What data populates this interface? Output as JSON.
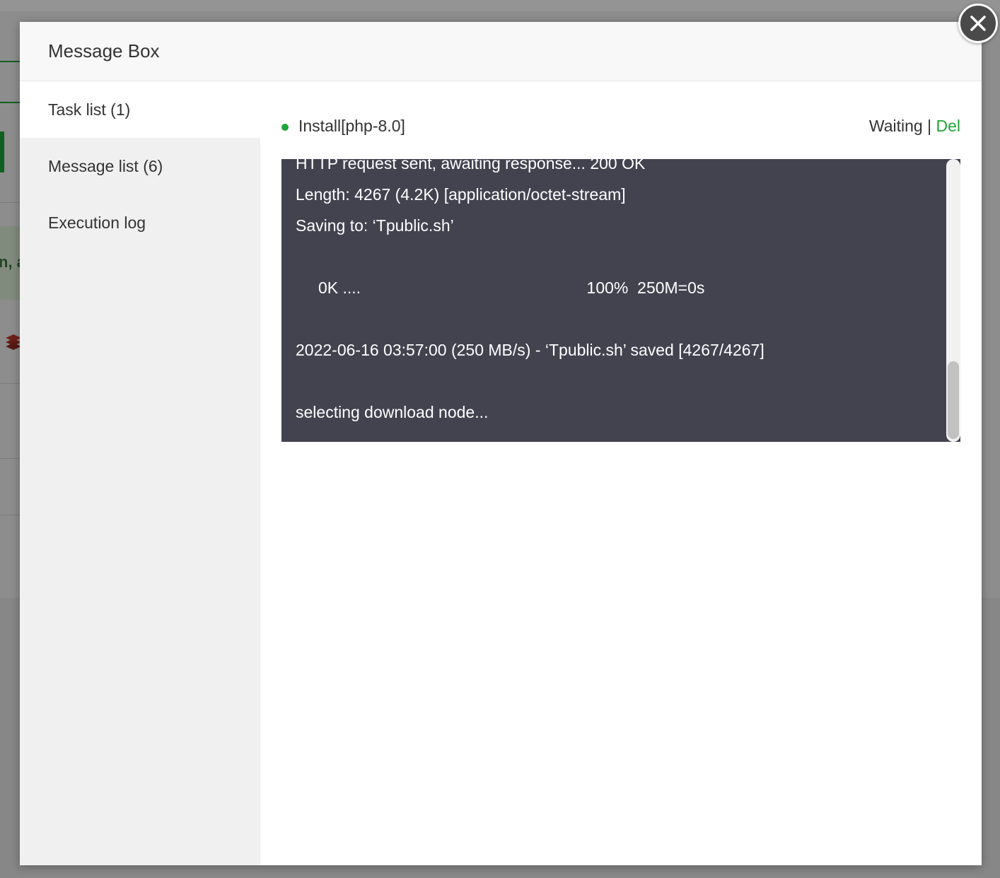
{
  "dialog": {
    "title": "Message Box"
  },
  "sidebar": {
    "items": [
      {
        "label": "Task list (1)",
        "active": true
      },
      {
        "label": "Message list (6)",
        "active": false
      },
      {
        "label": "Execution log",
        "active": false
      }
    ]
  },
  "task": {
    "name": "Install[php-8.0]",
    "status": "Waiting",
    "separator": " | ",
    "delete_label": "Del",
    "console_lines": [
      "HTTP request sent, awaiting response... 200 OK",
      "Length: 4267 (4.2K) [application/octet-stream]",
      "Saving to: ‘Tpublic.sh’",
      "",
      "     0K ....                                                  100%  250M=0s",
      "",
      "2022-06-16 03:57:00 (250 MB/s) - ‘Tpublic.sh’ saved [4267/4267]",
      "",
      "selecting download node..."
    ]
  },
  "background": {
    "notice_fragment": "n, a"
  },
  "colors": {
    "accent": "#20a53a",
    "console_bg": "#434350",
    "sidebar_bg": "#f0f0f0"
  },
  "icons": {
    "close": "close-icon",
    "status_dot": "status-dot-icon"
  }
}
